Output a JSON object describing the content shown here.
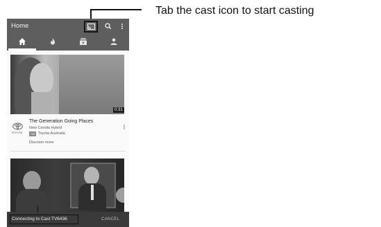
{
  "callout": {
    "text": "Tab the cast icon to start casting"
  },
  "appbar": {
    "title": "Home",
    "icons": [
      "cast-icon",
      "search-icon",
      "more-vert-icon"
    ]
  },
  "tabs": [
    {
      "name": "home",
      "icon": "home-icon",
      "active": true
    },
    {
      "name": "trending",
      "icon": "flame-icon",
      "active": false
    },
    {
      "name": "subscriptions",
      "icon": "subscriptions-icon",
      "active": false
    },
    {
      "name": "account",
      "icon": "account-icon",
      "active": false
    }
  ],
  "feed": {
    "items": [
      {
        "duration": "0:31",
        "title": "The Generation Going Places",
        "subtitle": "New Corolla Hybrid",
        "badge": "Ad",
        "advertiser": "Toyota Australia",
        "link": "Discover more",
        "channel_logo_text": "TOYOTA"
      }
    ]
  },
  "snackbar": {
    "message": "Connecting to Cast TV6436",
    "action": "CANCEL"
  },
  "colors": {
    "appbar": "#5e5e5e",
    "snackbar": "#3a3a3a",
    "background": "#fafafa"
  }
}
